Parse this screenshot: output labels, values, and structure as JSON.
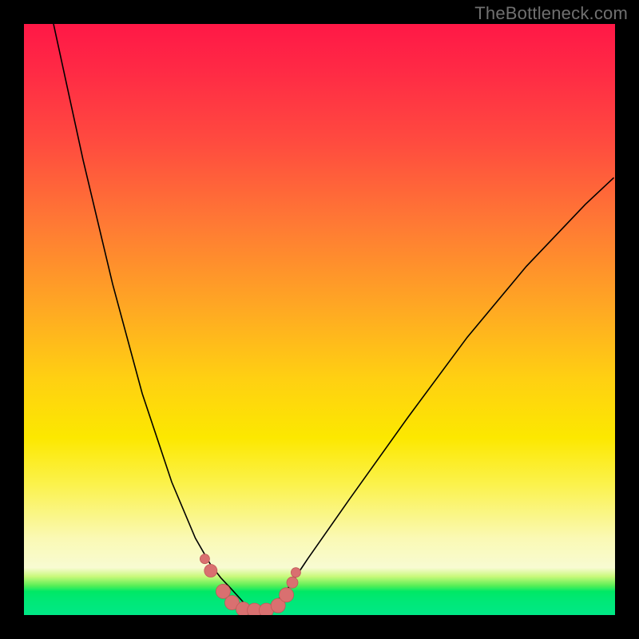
{
  "watermark": "TheBottleneck.com",
  "chart_data": {
    "type": "line",
    "title": "",
    "xlabel": "",
    "ylabel": "",
    "xlim": [
      0,
      1
    ],
    "ylim": [
      0,
      1
    ],
    "grid": false,
    "legend": false,
    "series": [
      {
        "name": "curve-left",
        "x": [
          0.05,
          0.1,
          0.15,
          0.2,
          0.25,
          0.29,
          0.316,
          0.333,
          0.35,
          0.37,
          0.392
        ],
        "values": [
          1.0,
          0.77,
          0.56,
          0.375,
          0.225,
          0.13,
          0.085,
          0.063,
          0.045,
          0.023,
          0.0
        ]
      },
      {
        "name": "curve-right",
        "x": [
          0.392,
          0.43,
          0.45,
          0.48,
          0.55,
          0.65,
          0.75,
          0.85,
          0.95,
          0.998
        ],
        "values": [
          0.0,
          0.025,
          0.05,
          0.095,
          0.195,
          0.335,
          0.47,
          0.59,
          0.695,
          0.74
        ]
      }
    ],
    "markers": {
      "name": "data-points",
      "x": [
        0.306,
        0.316,
        0.337,
        0.352,
        0.371,
        0.39,
        0.41,
        0.43,
        0.444,
        0.454,
        0.46
      ],
      "values": [
        0.095,
        0.075,
        0.04,
        0.021,
        0.01,
        0.008,
        0.008,
        0.016,
        0.034,
        0.055,
        0.072
      ],
      "radius": [
        6,
        8,
        9,
        9,
        9,
        9,
        9,
        9,
        9,
        7,
        6
      ]
    }
  }
}
